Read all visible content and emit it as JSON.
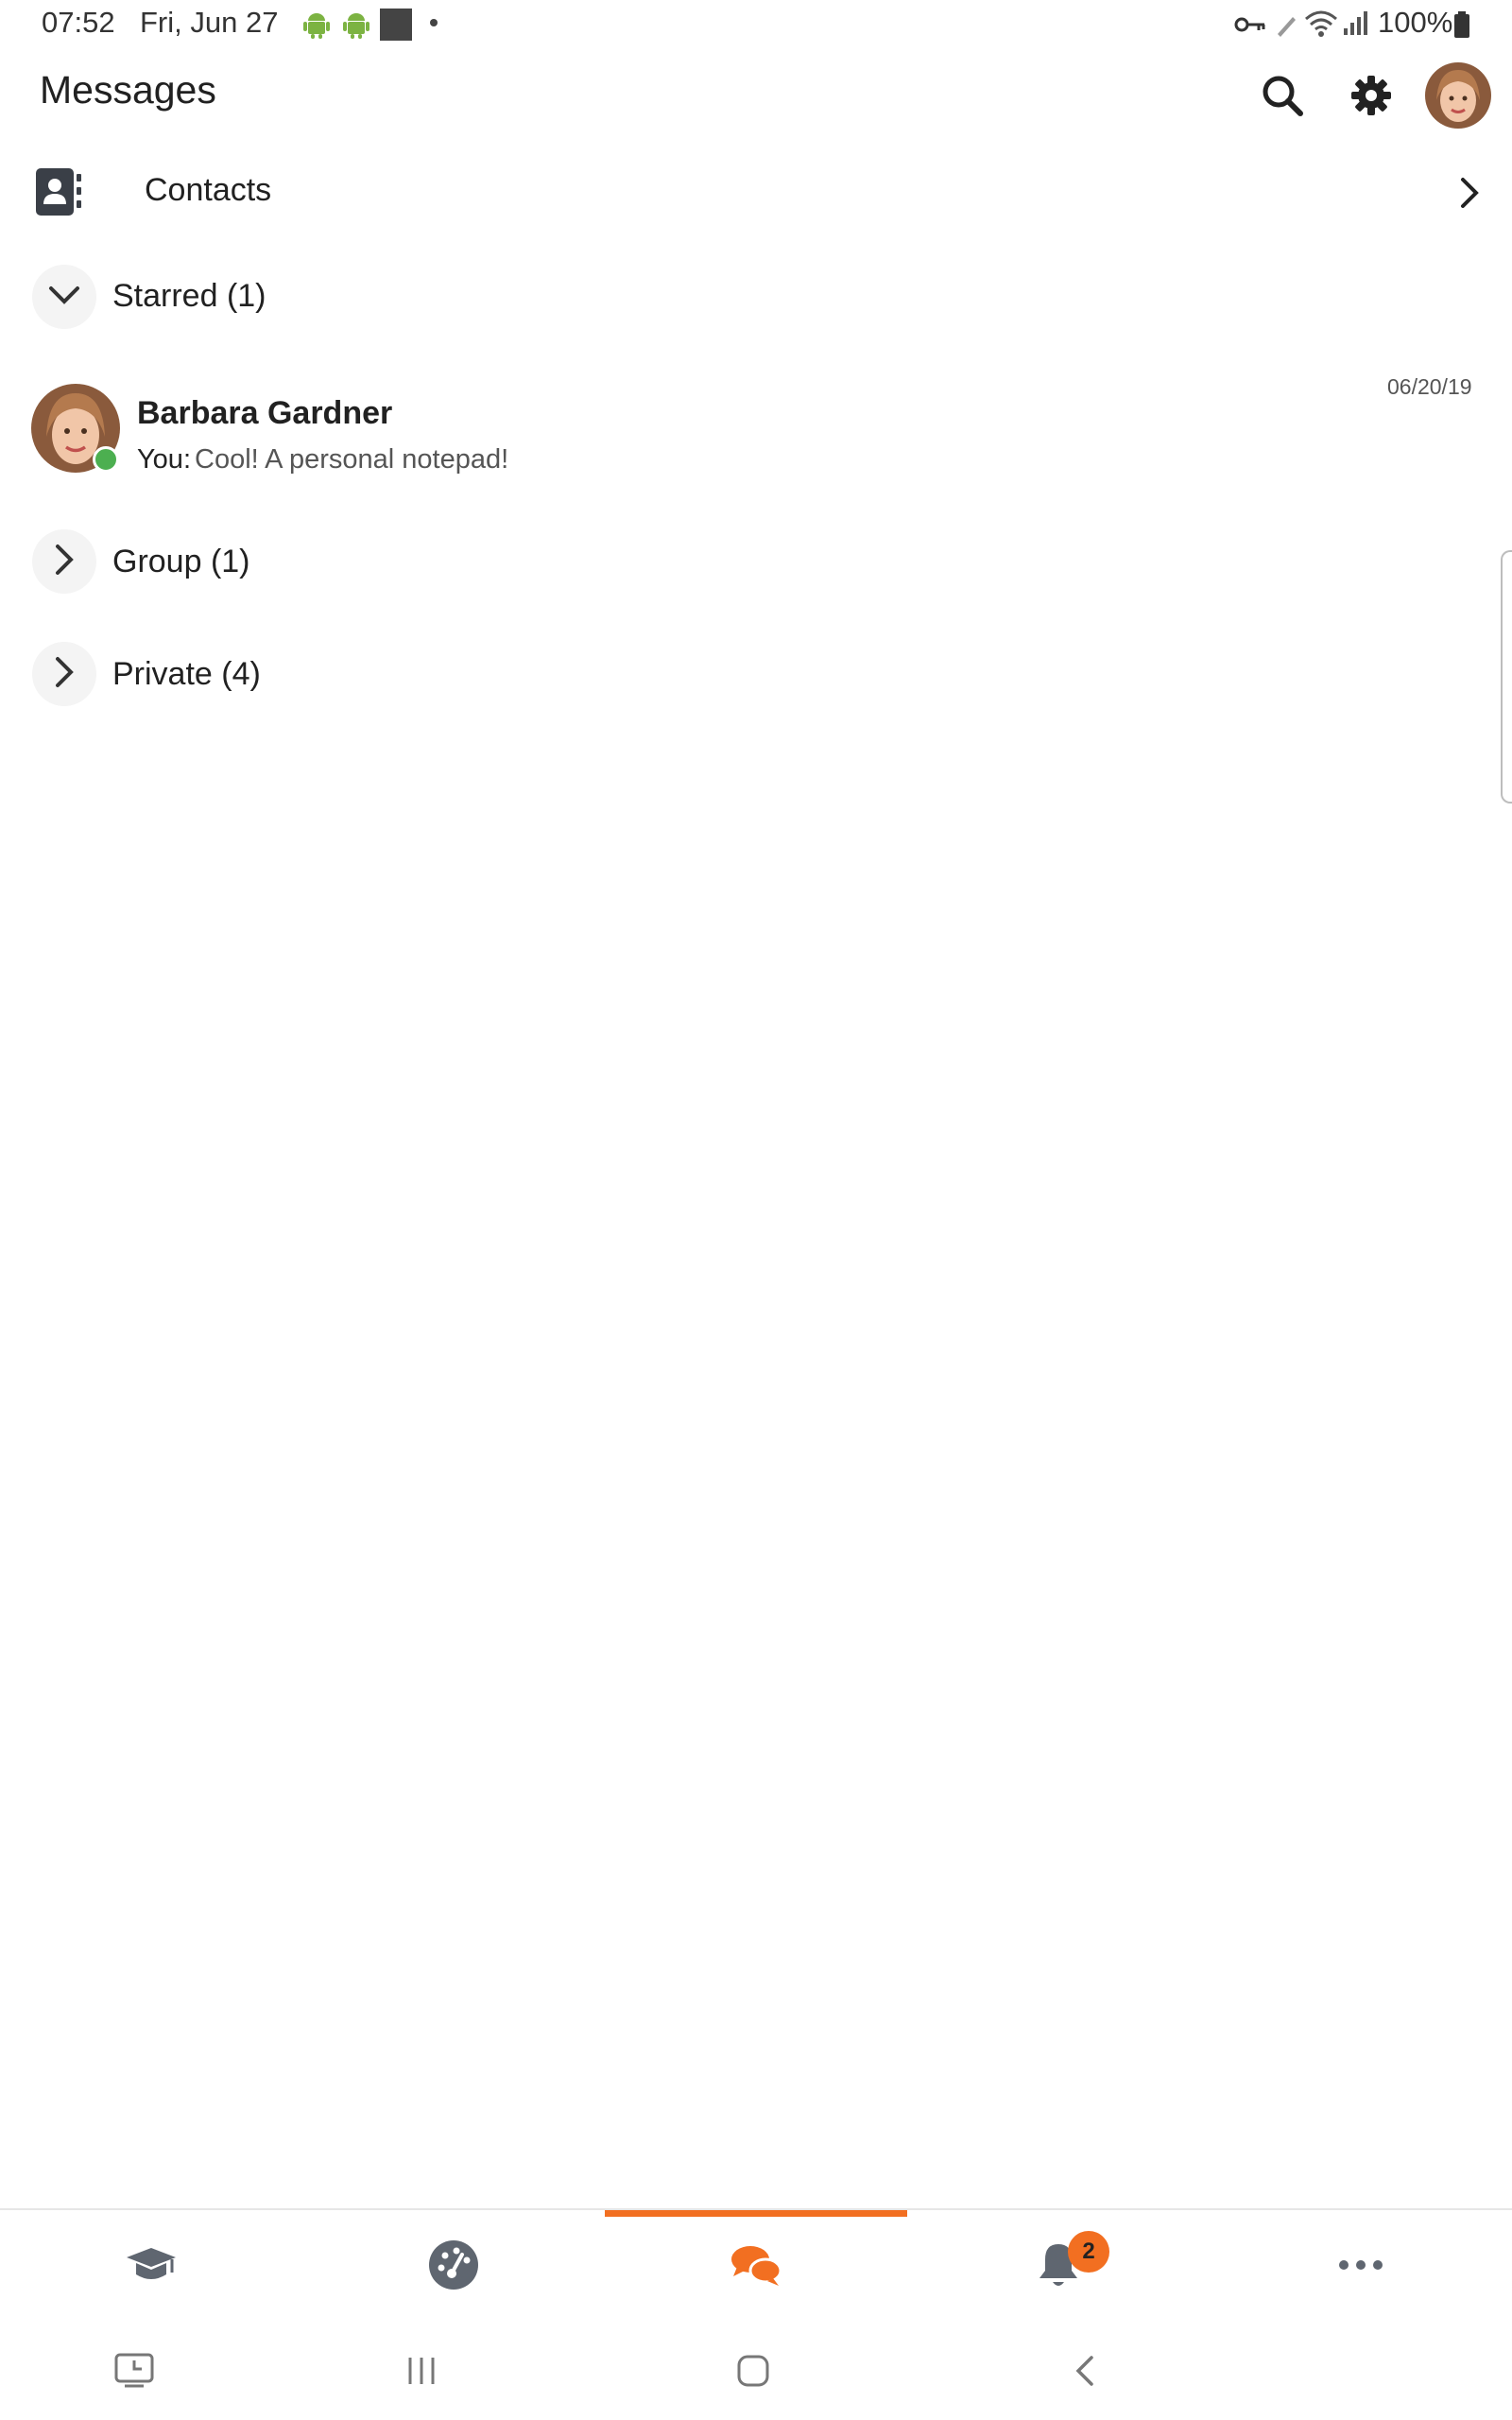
{
  "status_bar": {
    "time": "07:52",
    "date": "Fri, Jun 27",
    "battery": "100%"
  },
  "header": {
    "title": "Messages",
    "icons": [
      "search-icon",
      "gear-icon",
      "profile-avatar"
    ]
  },
  "contacts": {
    "label": "Contacts",
    "icon": "contacts-book-icon"
  },
  "sections": {
    "starred": {
      "label": "Starred (1)",
      "expanded": true
    },
    "group": {
      "label": "Group (1)",
      "expanded": false
    },
    "private": {
      "label": "Private (4)",
      "expanded": false
    }
  },
  "conversations": [
    {
      "name": "Barbara Gardner",
      "prefix": "You:",
      "preview": "Cool! A personal notepad!",
      "date": "06/20/19",
      "online": true
    }
  ],
  "bottom_nav": {
    "items": [
      "courses-icon",
      "dashboard-icon",
      "messages-icon",
      "notifications-icon",
      "more-icon"
    ],
    "active_index": 2,
    "notifications_badge": "2"
  },
  "colors": {
    "accent": "#f26f21",
    "online": "#4caf50",
    "icon_dark": "#3a3f47",
    "icon_gray": "#5f6670"
  }
}
